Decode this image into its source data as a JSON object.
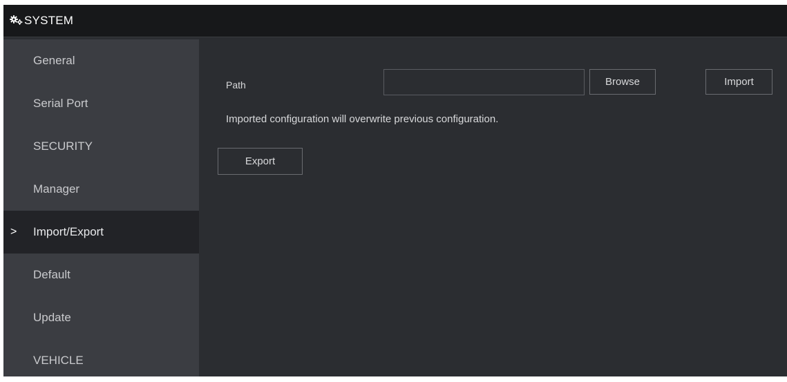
{
  "header": {
    "icon": "gears-icon",
    "title": "SYSTEM"
  },
  "sidebar": {
    "items": [
      {
        "label": "General",
        "active": false
      },
      {
        "label": "Serial Port",
        "active": false
      },
      {
        "label": "SECURITY",
        "active": false
      },
      {
        "label": "Manager",
        "active": false
      },
      {
        "label": "Import/Export",
        "active": true,
        "marker": ">"
      },
      {
        "label": "Default",
        "active": false
      },
      {
        "label": "Update",
        "active": false
      },
      {
        "label": "VEHICLE",
        "active": false
      }
    ]
  },
  "main": {
    "path_label": "Path",
    "path_value": "",
    "browse_label": "Browse",
    "import_label": "Import",
    "notice": "Imported configuration will overwrite previous configuration.",
    "export_label": "Export"
  },
  "colors": {
    "titlebar": "#17181a",
    "sidebar": "#3b3d42",
    "sidebar_active": "#222327",
    "content": "#2b2d31",
    "text": "#d8d9db"
  }
}
